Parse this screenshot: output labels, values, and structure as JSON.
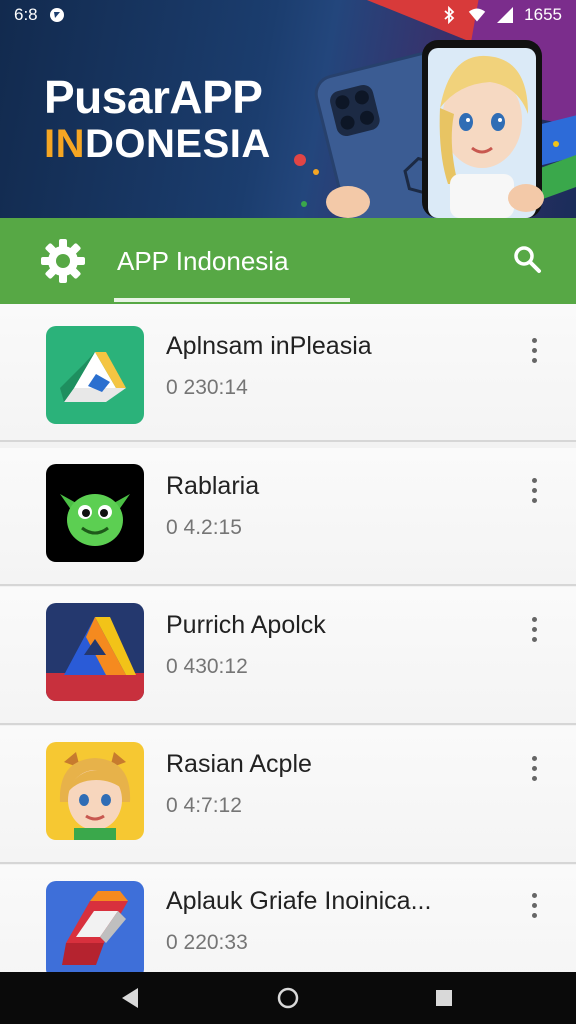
{
  "status_bar": {
    "time": "6:8",
    "right_text": "1655",
    "icons": [
      "notification-icon",
      "bluetooth-icon",
      "wifi-icon",
      "signal-icon"
    ]
  },
  "banner": {
    "title": "PusarAPP",
    "subtitle_accent": "IN",
    "subtitle_rest": "DONESIA"
  },
  "app_bar": {
    "title": "APP Indonesia",
    "icons": [
      "settings-icon",
      "search-icon"
    ],
    "color": "#57a845"
  },
  "apps": [
    {
      "name": "Aplnsam inPleasia",
      "meta": "0 230:14",
      "icon": "drive-style-icon"
    },
    {
      "name": "Rablaria",
      "meta": "0 4.2:15",
      "icon": "green-alien-icon"
    },
    {
      "name": "Purrich Apolck",
      "meta": "0 430:12",
      "icon": "triangle-logo-icon"
    },
    {
      "name": "Rasian Acple",
      "meta": "0 4:7:12",
      "icon": "cartoon-girl-icon"
    },
    {
      "name": "Aplauk Griafe Inoinica...",
      "meta": "0 220:33",
      "icon": "cube-logo-icon"
    }
  ],
  "nav": {
    "icons": [
      "back-icon",
      "home-icon",
      "recents-icon"
    ]
  }
}
